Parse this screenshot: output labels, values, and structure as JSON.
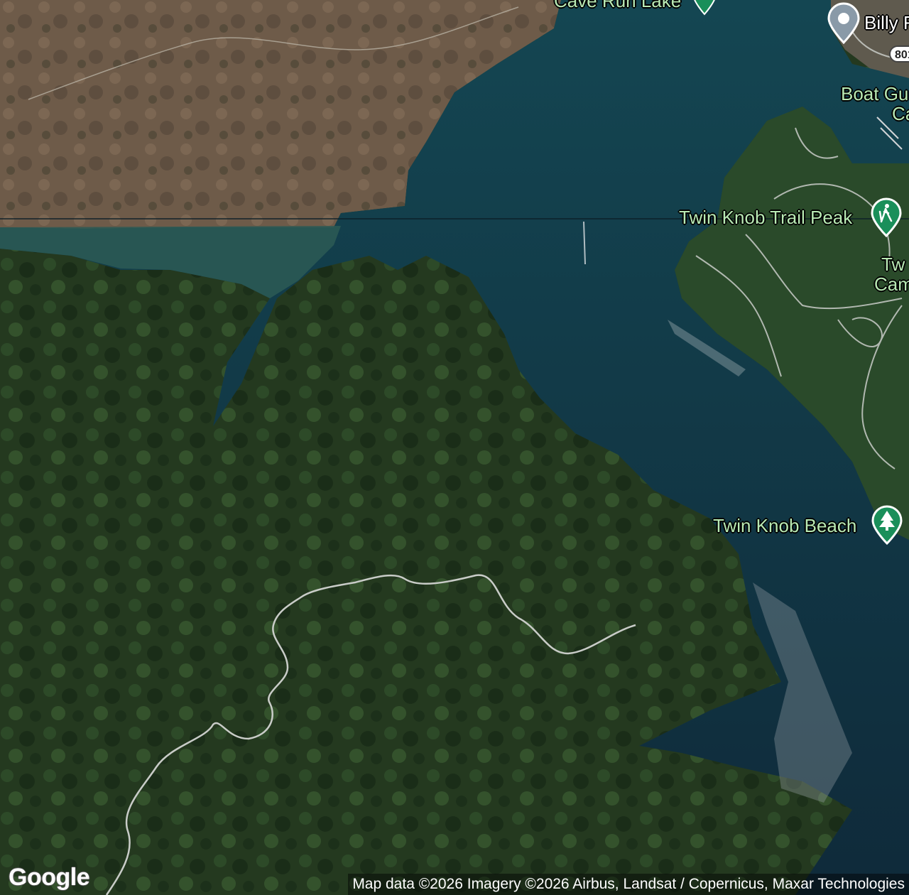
{
  "map": {
    "type": "satellite",
    "logo": "Google",
    "attribution": "Map data ©2026 Imagery ©2026 Airbus, Landsat / Copernicus, Maxar Technologies",
    "places": [
      {
        "id": "cave-run-lake",
        "label": "Cave Run Lake",
        "icon": "park-pin",
        "color": "#1a8f5a"
      },
      {
        "id": "billy",
        "label": "Billy F",
        "icon": "location-pin",
        "color": "#8a9aa8"
      },
      {
        "id": "boat-gun",
        "label": "Boat Gu",
        "icon": "none"
      },
      {
        "id": "boat-gun-ca",
        "label": "Ca",
        "icon": "none"
      },
      {
        "id": "twin-knob-trail-peak",
        "label": "Twin Knob Trail Peak",
        "icon": "hiking-pin",
        "color": "#1a8f5a"
      },
      {
        "id": "twin-knob-camp-1",
        "label": "Tw",
        "icon": "none"
      },
      {
        "id": "twin-knob-camp-2",
        "label": "Cam",
        "icon": "none"
      },
      {
        "id": "twin-knob-beach",
        "label": "Twin Knob Beach",
        "icon": "tree-pin",
        "color": "#1a8f5a"
      }
    ],
    "road_shield": "801",
    "colors": {
      "lake": "#123a44",
      "forest": "#1f3520",
      "winter_forest": "#6b5a48",
      "road": "#c9ccc8"
    }
  }
}
